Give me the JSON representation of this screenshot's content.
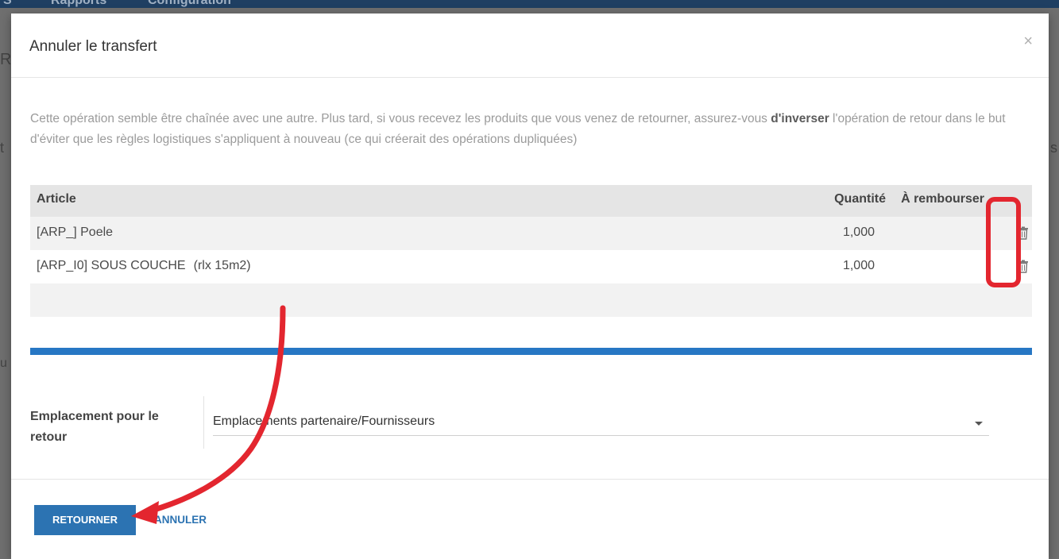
{
  "background": {
    "menu_items": [
      "S",
      "Rapports",
      "Configuration"
    ],
    "fragments": [
      "R",
      "t",
      "s",
      "u"
    ]
  },
  "modal": {
    "title": "Annuler le transfert",
    "close": "×",
    "info_before": "Cette opération semble être chaînée avec une autre. Plus tard, si vous recevez les produits que vous venez de retourner, assurez-vous ",
    "info_bold": "d'inverser",
    "info_after": " l'opération de retour dans le but d'éviter que les règles logistiques s'appliquent à nouveau (ce qui créerait des opérations dupliquées)",
    "table": {
      "headers": {
        "article": "Article",
        "quantity": "Quantité",
        "refund": "À rembourser"
      },
      "rows": [
        {
          "article": "[ARP_] Poele",
          "sub": "",
          "quantity": "1,000"
        },
        {
          "article": "[ARP_I0] SOUS COUCHE",
          "sub": "(rlx 15m2)",
          "quantity": "1,000"
        }
      ]
    },
    "location": {
      "label": "Emplacement pour le retour",
      "value": "Emplacements partenaire/Fournisseurs"
    },
    "buttons": {
      "primary": "RETOURNER",
      "secondary": "ANNULER"
    }
  },
  "colors": {
    "primary": "#2c73b2",
    "annotation": "#e3262f",
    "separator": "#2777c4"
  },
  "icons": {
    "delete": "trash-icon",
    "dropdown": "caret-down-icon"
  }
}
